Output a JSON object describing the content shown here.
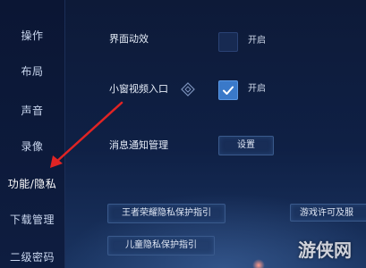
{
  "sidebar": {
    "items": [
      {
        "label": "操作"
      },
      {
        "label": "布局"
      },
      {
        "label": "声音"
      },
      {
        "label": "录像"
      },
      {
        "label": "功能/隐私"
      },
      {
        "label": "下载管理"
      },
      {
        "label": "二级密码"
      }
    ]
  },
  "settings": {
    "ui_animation": {
      "label": "界面动效",
      "toggle_text": "开启",
      "checked": false
    },
    "mini_window_video": {
      "label": "小窗视频入口",
      "toggle_text": "开启",
      "checked": true
    },
    "notification": {
      "label": "消息通知管理",
      "button": "设置"
    }
  },
  "links": {
    "privacy_guide": "王者荣耀隐私保护指引",
    "game_license": "游戏许可及服",
    "child_privacy": "儿童隐私保护指引"
  },
  "watermark": {
    "text": "游侠网"
  },
  "colors": {
    "accent": "#3a79c9",
    "arrow": "#e02424",
    "background": "#0f2045"
  }
}
